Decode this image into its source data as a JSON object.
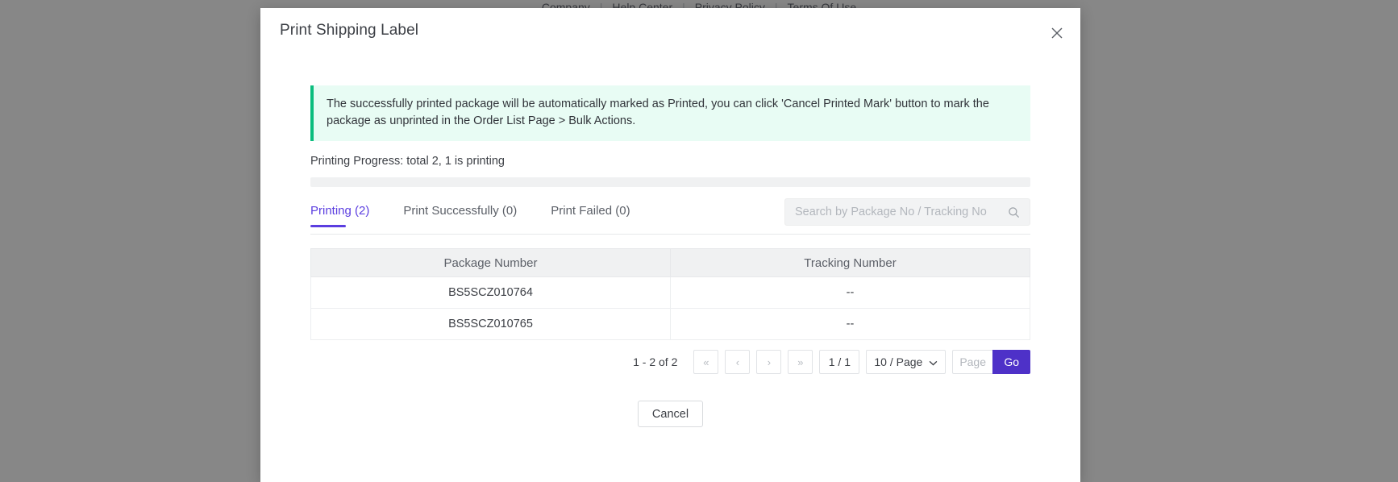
{
  "background_page": {
    "footer_links": [
      "Company",
      "Help Center",
      "Privacy Policy",
      "Terms Of Use"
    ],
    "separator": "|"
  },
  "modal": {
    "title": "Print Shipping Label",
    "close_icon": "close-icon",
    "alert": {
      "text": "The successfully printed package will be automatically marked as Printed, you can click 'Cancel Printed Mark' button to mark the package as unprinted in the Order List Page > Bulk Actions.",
      "accent_color": "#0bbd7e",
      "background_color": "#e8fcf4"
    },
    "progress": {
      "label": "Printing Progress: total 2, 1 is printing",
      "percent": 0,
      "track_color": "#f0f1f2"
    },
    "tabs": [
      {
        "label": "Printing (2)",
        "active": true
      },
      {
        "label": "Print Successfully (0)",
        "active": false
      },
      {
        "label": "Print Failed (0)",
        "active": false
      }
    ],
    "active_tab_color": "#5b3ee0",
    "search": {
      "placeholder": "Search by Package No / Tracking No",
      "value": "",
      "icon": "search-icon"
    },
    "table": {
      "columns": [
        "Package Number",
        "Tracking Number"
      ],
      "rows": [
        {
          "package_number": "BS5SCZ010764",
          "tracking_number": "--"
        },
        {
          "package_number": "BS5SCZ010765",
          "tracking_number": "--"
        }
      ]
    },
    "pagination": {
      "range_text": "1 - 2 of 2",
      "first_icon": "«",
      "prev_icon": "‹",
      "next_icon": "›",
      "last_icon": "»",
      "page_indicator": "1 / 1",
      "page_size": "10 / Page",
      "page_input_placeholder": "Page",
      "page_input_value": "",
      "go_label": "Go",
      "go_color": "#4e31c8"
    },
    "cancel_label": "Cancel"
  }
}
